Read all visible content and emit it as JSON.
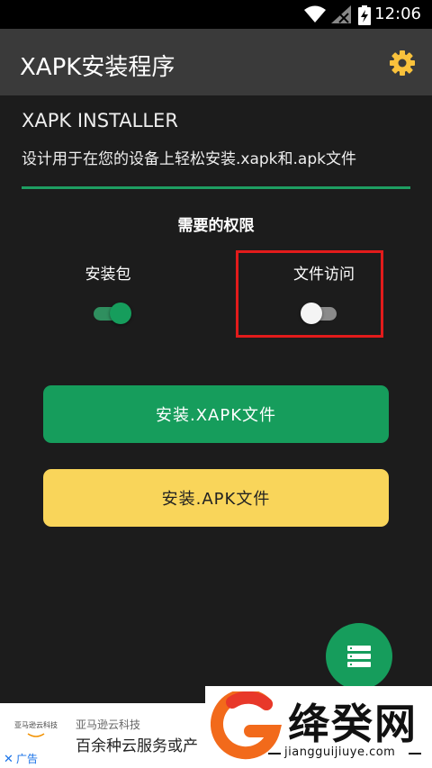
{
  "status_bar": {
    "time": "12:06"
  },
  "app_bar": {
    "title": "XAPK安装程序"
  },
  "header": {
    "subtitle": "XAPK INSTALLER",
    "description": "设计用于在您的设备上轻松安装.xapk和.apk文件"
  },
  "permissions": {
    "title": "需要的权限",
    "install_packages": {
      "label": "安装包",
      "enabled": true
    },
    "file_access": {
      "label": "文件访问",
      "enabled": false
    }
  },
  "buttons": {
    "install_xapk": "安装.XAPK文件",
    "install_apk": "安装.APK文件"
  },
  "colors": {
    "accent_green": "#169d5c",
    "accent_yellow": "#f9d55a",
    "highlight_red": "#e21b1b",
    "background": "#1c1c1c",
    "app_bar": "#3a3a3a"
  },
  "ad": {
    "logo_text": "亚马逊云科技",
    "company": "亚马逊云科技",
    "text": "百余种云服务或产",
    "tag": "广告"
  },
  "watermark": {
    "title": "绛癸网",
    "url": "jiangguijiuye.com"
  },
  "icons": [
    "wifi-icon",
    "signal-icon",
    "battery-icon",
    "gear-icon",
    "list-icon",
    "close-icon"
  ]
}
